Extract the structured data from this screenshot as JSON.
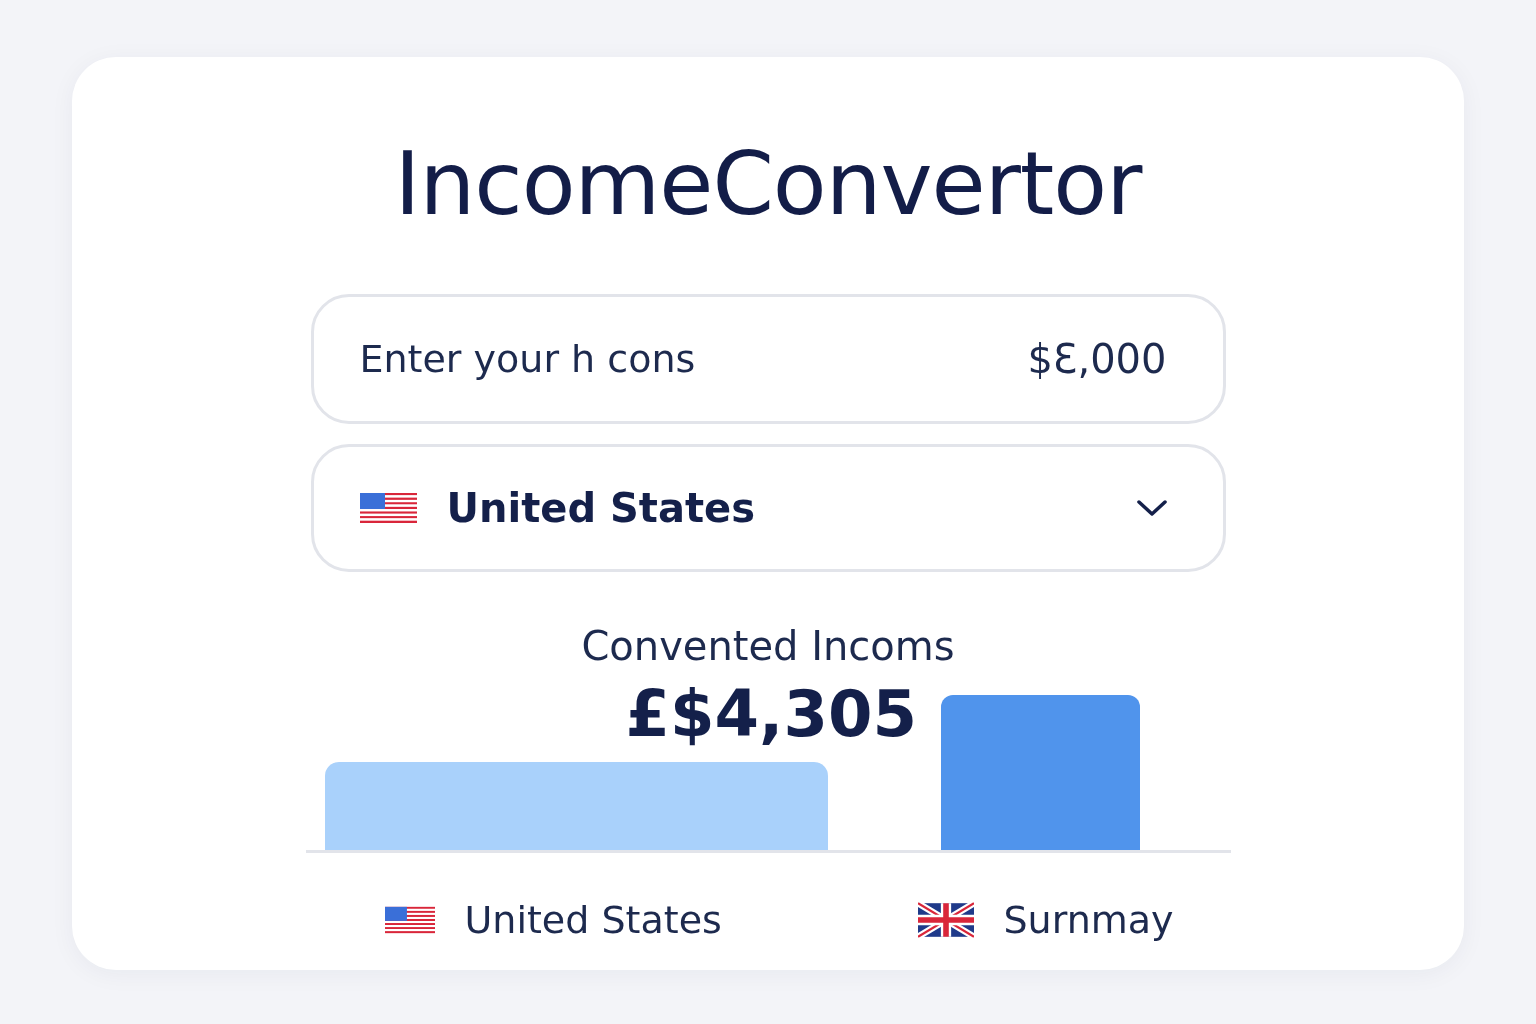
{
  "title": "IncomeConvertor",
  "income_field": {
    "label": "Enter your h cons",
    "value": "$Ɛ,000"
  },
  "country_select": {
    "value": "United States",
    "flag": {
      "kind": "us"
    }
  },
  "result": {
    "heading": "Convented Incoms",
    "amount": "£$4,305"
  },
  "legend": [
    {
      "label": "United States",
      "flag": {
        "kind": "us"
      }
    },
    {
      "label": "Surnmay",
      "flag": {
        "kind": "uk"
      }
    }
  ]
}
